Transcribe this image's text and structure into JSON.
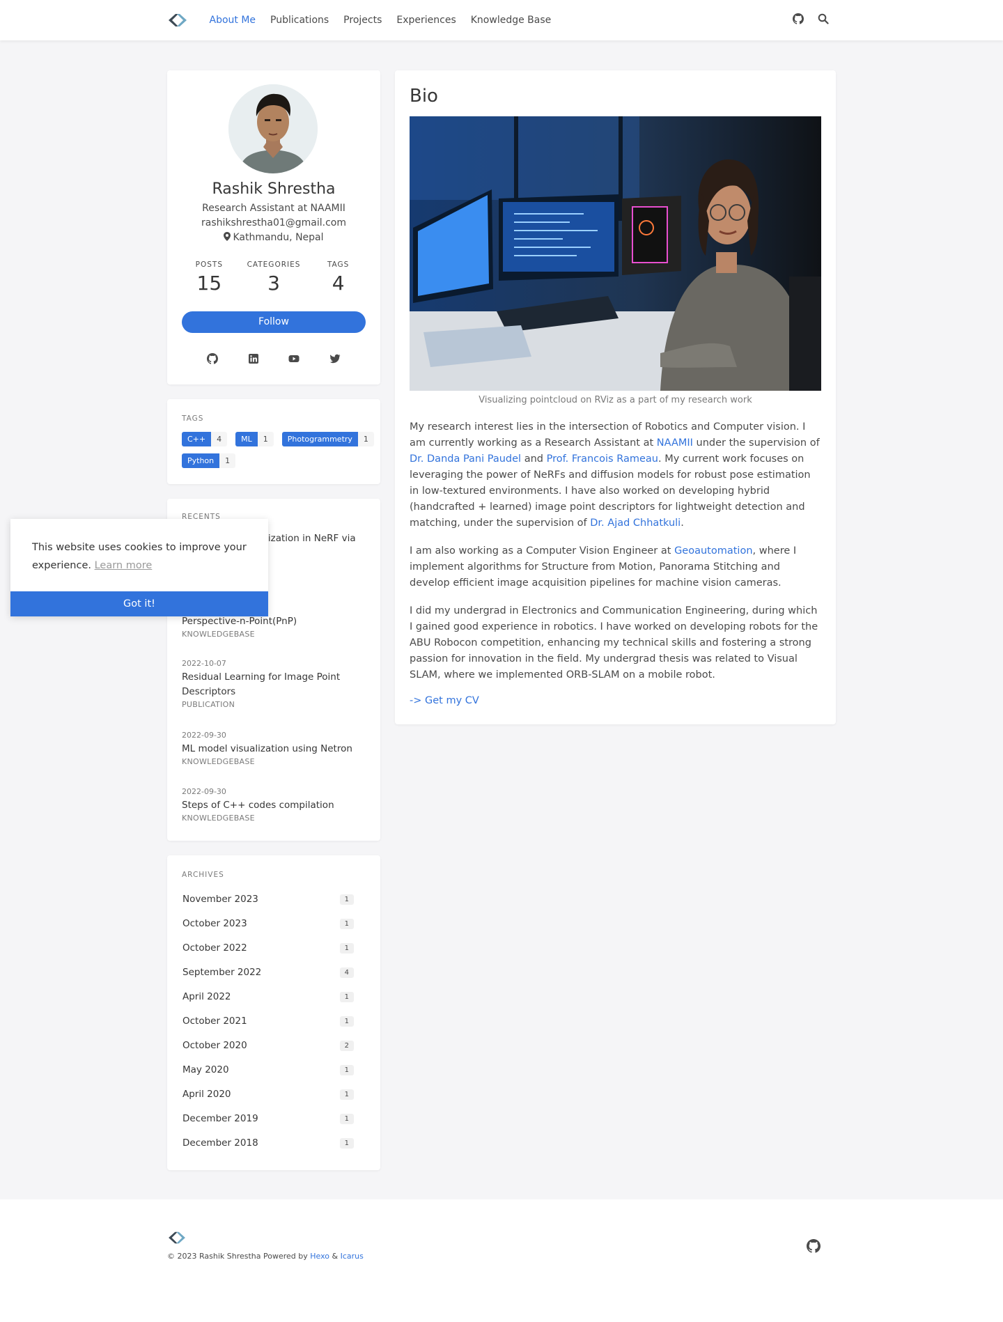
{
  "nav": {
    "items": [
      {
        "label": "About Me",
        "active": true
      },
      {
        "label": "Publications"
      },
      {
        "label": "Projects"
      },
      {
        "label": "Experiences"
      },
      {
        "label": "Knowledge Base"
      }
    ],
    "icons": [
      "github-icon",
      "search-icon"
    ]
  },
  "profile": {
    "name": "Rashik Shrestha",
    "role": "Research Assistant at NAAMII",
    "email": "rashikshrestha01@gmail.com",
    "location": "Kathmandu, Nepal",
    "stats": [
      {
        "label": "POSTS",
        "value": "15"
      },
      {
        "label": "CATEGORIES",
        "value": "3"
      },
      {
        "label": "TAGS",
        "value": "4"
      }
    ],
    "follow_label": "Follow",
    "socials": [
      "github-icon",
      "linkedin-icon",
      "youtube-icon",
      "twitter-icon"
    ]
  },
  "tags": {
    "title": "TAGS",
    "items": [
      {
        "name": "C++",
        "count": "4"
      },
      {
        "name": "ML",
        "count": "1"
      },
      {
        "name": "Photogrammetry",
        "count": "1"
      },
      {
        "name": "Python",
        "count": "1"
      }
    ]
  },
  "recents": {
    "title": "RECENTS",
    "items": [
      {
        "date": "",
        "title": "...alization in NeRF via",
        "category": ""
      },
      {
        "date": "",
        "title": "Perspective-n-Point(PnP)",
        "category": "KNOWLEDGEBASE"
      },
      {
        "date": "2022-10-07",
        "title": "Residual Learning for Image Point Descriptors",
        "category": "PUBLICATION"
      },
      {
        "date": "2022-09-30",
        "title": "ML model visualization using Netron",
        "category": "KNOWLEDGEBASE"
      },
      {
        "date": "2022-09-30",
        "title": "Steps of C++ codes compilation",
        "category": "KNOWLEDGEBASE"
      }
    ]
  },
  "archives": {
    "title": "ARCHIVES",
    "items": [
      {
        "label": "November 2023",
        "count": "1"
      },
      {
        "label": "October 2023",
        "count": "1"
      },
      {
        "label": "October 2022",
        "count": "1"
      },
      {
        "label": "September 2022",
        "count": "4"
      },
      {
        "label": "April 2022",
        "count": "1"
      },
      {
        "label": "October 2021",
        "count": "1"
      },
      {
        "label": "October 2020",
        "count": "2"
      },
      {
        "label": "May 2020",
        "count": "1"
      },
      {
        "label": "April 2020",
        "count": "1"
      },
      {
        "label": "December 2019",
        "count": "1"
      },
      {
        "label": "December 2018",
        "count": "1"
      }
    ]
  },
  "bio": {
    "title": "Bio",
    "caption": "Visualizing pointcloud on RViz as a part of my research work",
    "p1": {
      "t1": "My research interest lies in the intersection of Robotics and Computer vision. I am currently working as a Research Assistant at ",
      "l1": "NAAMII",
      "t2": " under the supervision of ",
      "l2": "Dr. Danda Pani Paudel",
      "t3": " and ",
      "l3": "Prof. Francois Rameau",
      "t4": ". My current work focuses on leveraging the power of NeRFs and diffusion models for robust pose estimation in low-textured environments. I have also worked on developing hybrid (handcrafted + learned) image point descriptors for lightweight detection and matching, under the supervision of ",
      "l4": "Dr. Ajad Chhatkuli",
      "t5": "."
    },
    "p2": {
      "t1": "I am also working as a Computer Vision Engineer at ",
      "l1": "Geoautomation",
      "t2": ", where I implement algorithms for Structure from Motion, Panorama Stitching and develop efficient image acquisition pipelines for machine vision cameras."
    },
    "p3": "I did my undergrad in Electronics and Communication Engineering, during which I gained good experience in robotics. I have worked on developing robots for the ABU Robocon competition, enhancing my technical skills and fostering a strong passion for innovation in the field. My undergrad thesis was related to Visual SLAM, where we implemented ORB-SLAM on a mobile robot.",
    "cv_label": "-> Get my CV"
  },
  "footer": {
    "copyright": "© 2023 Rashik Shrestha  Powered by ",
    "hexo": "Hexo",
    "amp": " & ",
    "icarus": "Icarus"
  },
  "cookie": {
    "message": "This website uses cookies to improve your experience. ",
    "learn_more": "Learn more",
    "button": "Got it!"
  },
  "colors": {
    "accent": "#3273dc",
    "background": "#f5f5f7"
  }
}
